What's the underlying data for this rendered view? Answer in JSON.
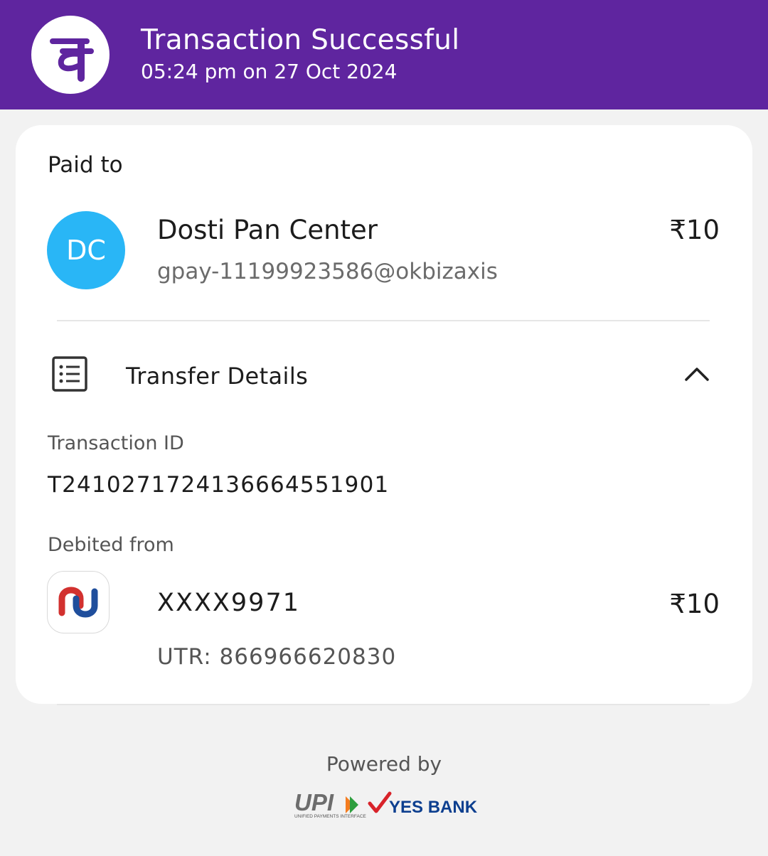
{
  "header": {
    "title": "Transaction Successful",
    "timestamp": "05:24 pm on 27 Oct 2024",
    "logo_icon": "phonepe-logo-icon",
    "background_color": "#5f259f"
  },
  "paid_to": {
    "label": "Paid to",
    "avatar_initials": "DC",
    "avatar_color": "#29b6f6",
    "name": "Dosti Pan Center",
    "upi_id": "gpay-11199923586@okbizaxis",
    "amount": "₹10"
  },
  "transfer_details": {
    "title": "Transfer Details",
    "icon": "list-details-icon",
    "toggle_icon": "chevron-up-icon",
    "transaction_id_label": "Transaction ID",
    "transaction_id": "T2410271724136664551901",
    "debited_from_label": "Debited from",
    "bank_icon": "union-bank-logo-icon",
    "account": "XXXX9971",
    "amount": "₹10",
    "utr": "UTR: 866966620830"
  },
  "footer": {
    "powered_by": "Powered by",
    "upi_text": "UPI",
    "upi_subtext": "UNIFIED PAYMENTS INTERFACE",
    "bank_text": "YES BANK"
  }
}
